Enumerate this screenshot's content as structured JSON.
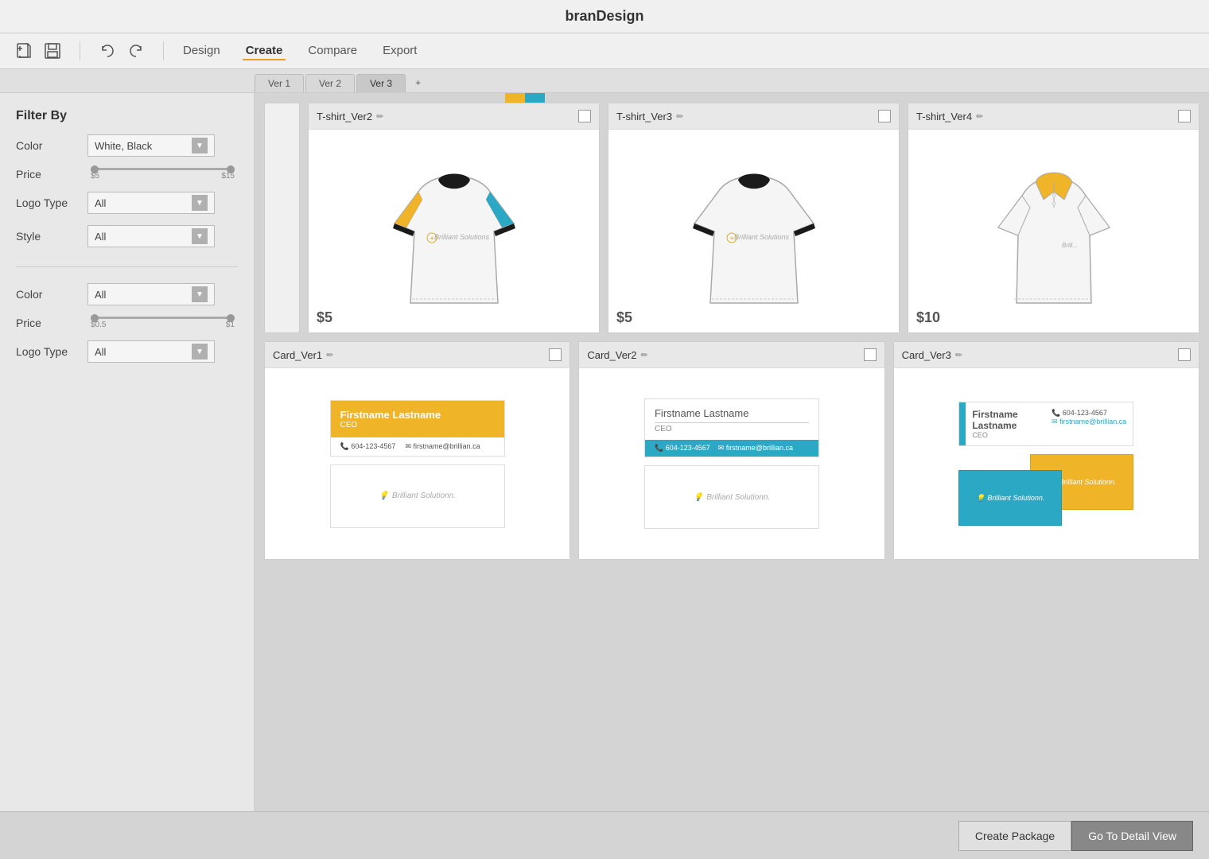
{
  "app": {
    "title": "branDesign"
  },
  "toolbar": {
    "nav_tabs": [
      "Design",
      "Create",
      "Compare",
      "Export"
    ],
    "active_tab": "Create"
  },
  "version_tabs": [
    "Ver 1",
    "Ver 2",
    "Ver 3",
    "+"
  ],
  "sidebar": {
    "tshirt_section": {
      "filter_title": "Filter By",
      "color_label": "Color",
      "color_value": "White, Black",
      "price_label": "Price",
      "price_min": "$5",
      "price_max": "$15",
      "logotype_label": "Logo Type",
      "logotype_value": "All",
      "style_label": "Style",
      "style_value": "All"
    },
    "card_section": {
      "color_label": "Color",
      "color_value": "All",
      "price_label": "Price",
      "price_min": "$0.5",
      "price_max": "$1",
      "logotype_label": "Logo Type",
      "logotype_value": "All"
    }
  },
  "tshirts": [
    {
      "name": "T-shirt_Ver2",
      "price": "$5",
      "type": "ringer"
    },
    {
      "name": "T-shirt_Ver3",
      "price": "$5",
      "type": "ringer"
    },
    {
      "name": "T-shirt_Ver4",
      "price": "$10",
      "type": "polo"
    }
  ],
  "cards": [
    {
      "name": "Card_Ver1",
      "style": "orange-top"
    },
    {
      "name": "Card_Ver2",
      "style": "teal-stripe"
    },
    {
      "name": "Card_Ver3",
      "style": "two-tone"
    }
  ],
  "buttons": {
    "create_package": "Create Package",
    "detail_view": "Go To Detail View"
  },
  "colors": {
    "yellow": "#f0b429",
    "teal": "#2aa8c4",
    "black": "#1a1a1a"
  }
}
